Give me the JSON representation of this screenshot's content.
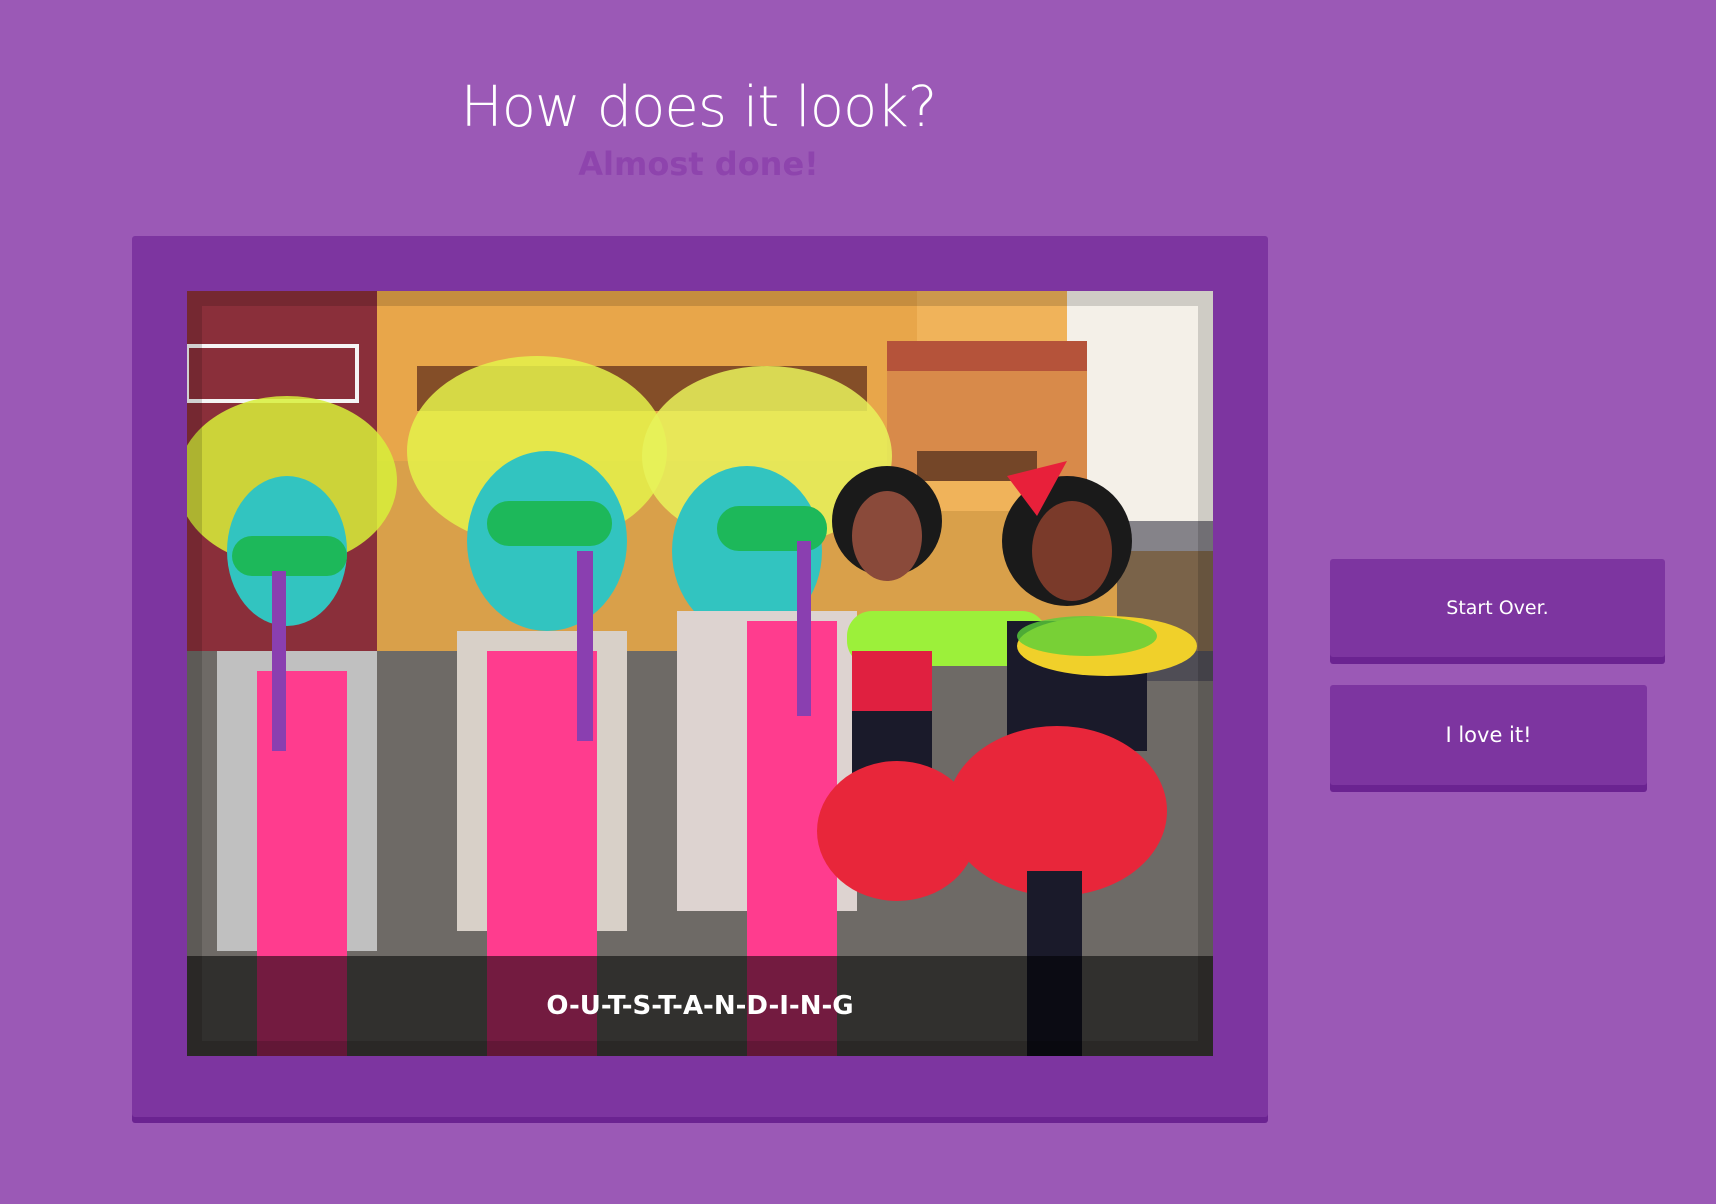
{
  "page": {
    "title": "How does it look?",
    "subtitle": "Almost done!"
  },
  "photo": {
    "caption": "O-U-T-S-T-A-N-D-I-N-G"
  },
  "actions": {
    "start_over_label": "Start Over.",
    "love_label": "I love it!"
  },
  "colors": {
    "background": "#9b59b6",
    "panel": "#7d35a0",
    "subtitle": "#8e44ad",
    "text": "#ffffff"
  }
}
